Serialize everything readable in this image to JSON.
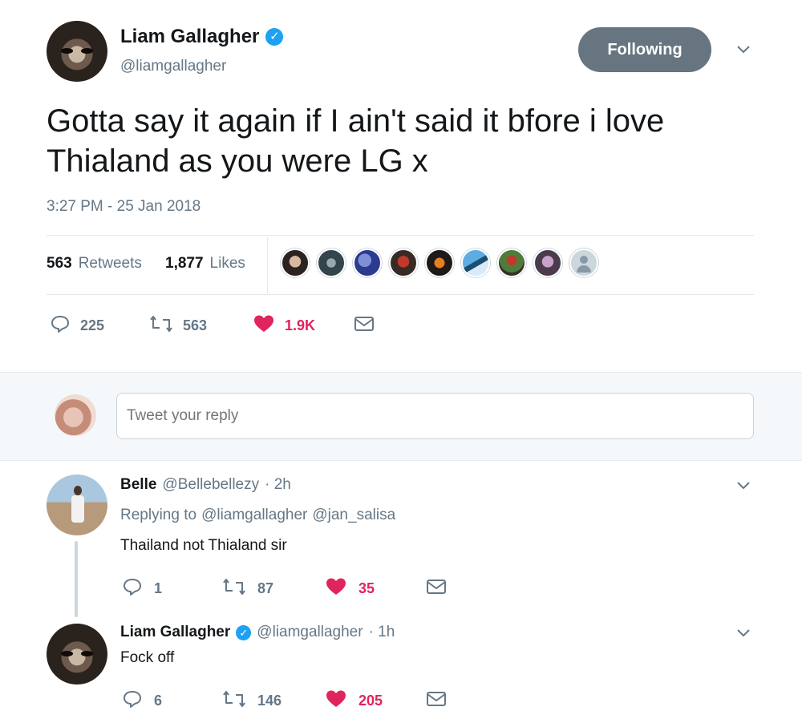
{
  "tweet": {
    "author": {
      "name": "Liam Gallagher",
      "handle": "@liamgallagher",
      "verified": true
    },
    "follow_label": "Following",
    "text_line1": "Gotta say it again if I ain't said it bfore i love",
    "text_line2": "Thialand as you were LG x",
    "timestamp": "3:27 PM - 25 Jan 2018",
    "stats": {
      "retweets_count": "563",
      "retweets_label": "Retweets",
      "likes_count": "1,877",
      "likes_label": "Likes"
    },
    "actions": {
      "replies": "225",
      "retweets": "563",
      "likes": "1.9K"
    }
  },
  "reply_box": {
    "placeholder": "Tweet your reply"
  },
  "replies": [
    {
      "name": "Belle",
      "handle": "@Bellebellezy",
      "time": "· 2h",
      "replying_prefix": "Replying to",
      "replying_to_1": "@liamgallagher",
      "replying_to_2": "@jan_salisa",
      "text": "Thailand not Thialand sir",
      "actions": {
        "replies": "1",
        "retweets": "87",
        "likes": "35"
      }
    },
    {
      "name": "Liam Gallagher",
      "handle": "@liamgallagher",
      "time": "· 1h",
      "text": "Fock off",
      "actions": {
        "replies": "6",
        "retweets": "146",
        "likes": "205"
      }
    }
  ],
  "colors": {
    "accent": "#1da1f2",
    "like": "#e0245e",
    "muted": "#657786",
    "follow_bg": "#66757f"
  }
}
